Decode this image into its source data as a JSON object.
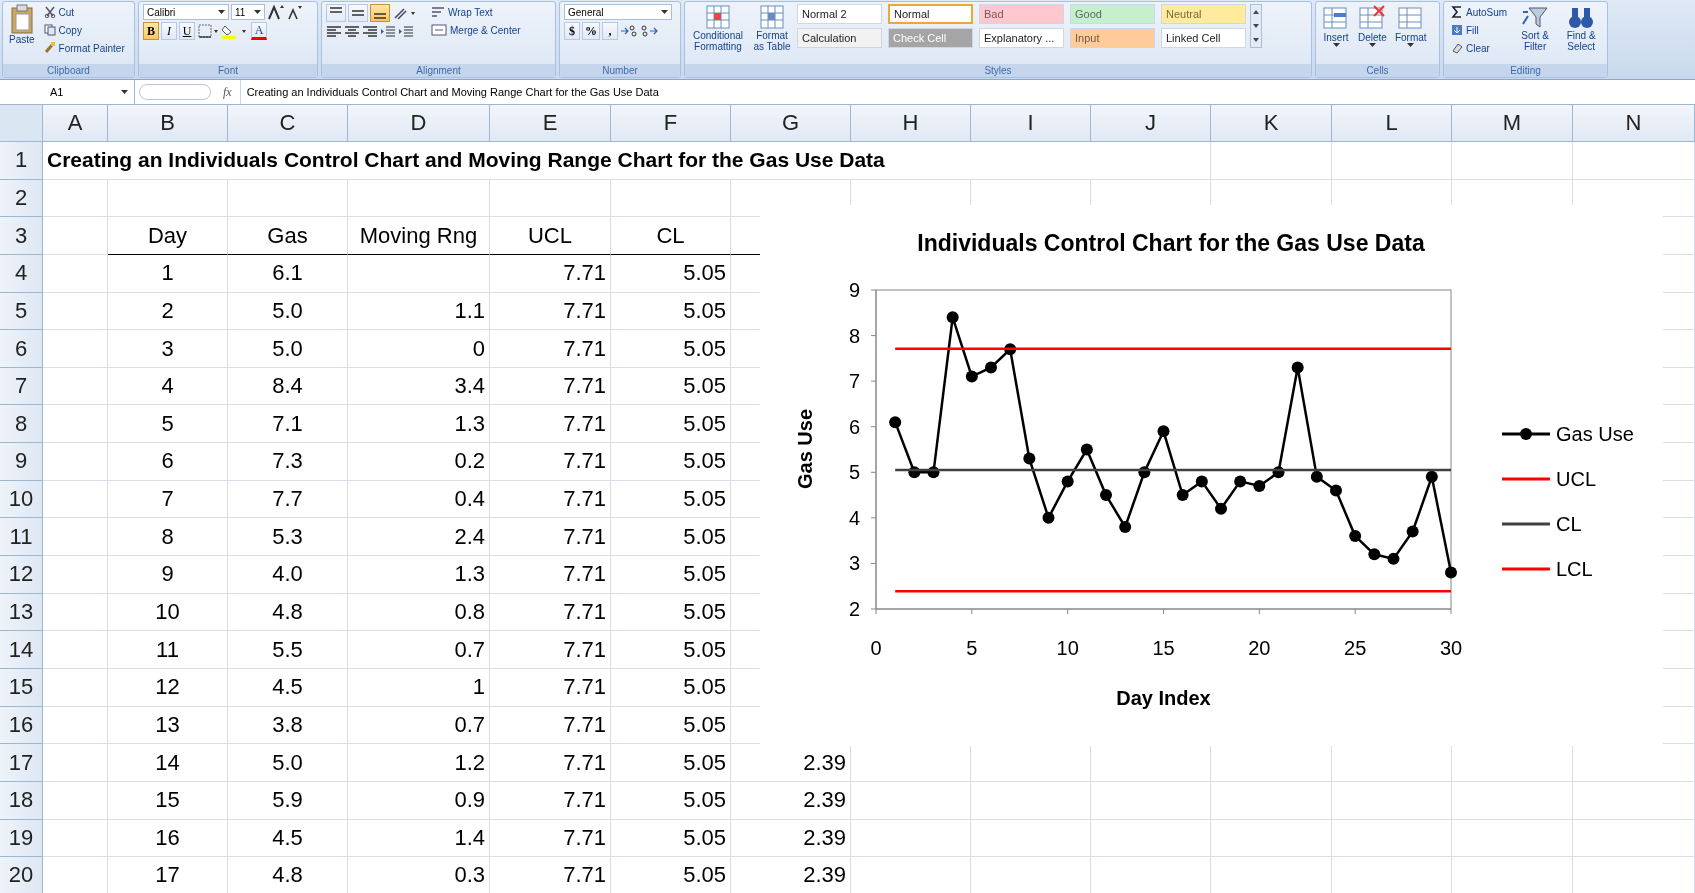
{
  "ribbon": {
    "groups": [
      {
        "kind": "clipboard",
        "label": "Clipboard",
        "paste": "Paste",
        "items": [
          "Cut",
          "Copy",
          "Format Painter"
        ]
      },
      {
        "kind": "font",
        "label": "Font",
        "font_name": "Calibri",
        "font_size": "11",
        "format_buttons": [
          {
            "label": "B",
            "selected": true
          },
          {
            "label": "I",
            "selected": false
          },
          {
            "label": "U",
            "selected": false
          }
        ],
        "font_color": "A"
      },
      {
        "kind": "alignment",
        "label": "Alignment",
        "vertical_align": [
          {
            "selected": false
          },
          {
            "selected": false
          },
          {
            "selected": true
          }
        ],
        "wrap": "Wrap Text",
        "merge": "Merge & Center"
      },
      {
        "kind": "number",
        "label": "Number",
        "format": "General",
        "symbols": [
          "$",
          "%",
          ","
        ]
      },
      {
        "kind": "styles",
        "label": "Styles",
        "buttons": [
          "Conditional Formatting",
          "Format as Table"
        ],
        "gallery": [
          {
            "label": "Normal 2",
            "color": "#ffffff",
            "selected": false
          },
          {
            "label": "Normal",
            "color": "#ffffff",
            "selected": true
          },
          {
            "label": "Bad",
            "color": "#ffc7ce",
            "selected": false
          },
          {
            "label": "Good",
            "color": "#c6efce",
            "selected": false
          },
          {
            "label": "Neutral",
            "color": "#ffeb9c",
            "selected": false
          },
          {
            "label": "Calculation",
            "color": "#f2f2f2",
            "selected": false
          },
          {
            "label": "Check Cell",
            "color": "#a5a5a5",
            "selected": false
          },
          {
            "label": "Explanatory ...",
            "color": "#ffffff",
            "selected": false
          },
          {
            "label": "Input",
            "color": "#ffcc99",
            "selected": false
          },
          {
            "label": "Linked Cell",
            "color": "#ffffff",
            "selected": false
          }
        ]
      },
      {
        "kind": "cells",
        "label": "Cells",
        "buttons": [
          "Insert",
          "Delete",
          "Format"
        ]
      },
      {
        "kind": "editing",
        "label": "Editing",
        "items": [
          "AutoSum",
          "Fill",
          "Clear"
        ],
        "buttons": [
          "Sort & Filter",
          "Find & Select"
        ]
      }
    ]
  },
  "formula_bar": {
    "name_box": "A1",
    "fx": "fx",
    "content": "Creating an Individuals Control Chart and Moving Range Chart for the Gas Use Data"
  },
  "sheet": {
    "columns": [
      "A",
      "B",
      "C",
      "D",
      "E",
      "F",
      "G",
      "H",
      "I",
      "J",
      "K",
      "L",
      "M",
      "N"
    ],
    "rows": [
      {
        "number": "1",
        "kind": "title",
        "cells": {
          "A": "Creating an Individuals Control Chart and Moving Range Chart for the Gas Use Data"
        }
      },
      {
        "number": "2",
        "kind": "data",
        "cells": {}
      },
      {
        "number": "3",
        "kind": "header",
        "cells": {
          "B": "Day",
          "C": "Gas",
          "D": "Moving Rng",
          "E": "UCL",
          "F": "CL"
        }
      },
      {
        "number": "4",
        "kind": "data",
        "cells": {
          "B": "1",
          "C": "6.1",
          "E": "7.71",
          "F": "5.05"
        }
      },
      {
        "number": "5",
        "kind": "data",
        "cells": {
          "B": "2",
          "C": "5.0",
          "D": "1.1",
          "E": "7.71",
          "F": "5.05"
        }
      },
      {
        "number": "6",
        "kind": "data",
        "cells": {
          "B": "3",
          "C": "5.0",
          "D": "0",
          "E": "7.71",
          "F": "5.05"
        }
      },
      {
        "number": "7",
        "kind": "data",
        "cells": {
          "B": "4",
          "C": "8.4",
          "D": "3.4",
          "E": "7.71",
          "F": "5.05"
        }
      },
      {
        "number": "8",
        "kind": "data",
        "cells": {
          "B": "5",
          "C": "7.1",
          "D": "1.3",
          "E": "7.71",
          "F": "5.05"
        }
      },
      {
        "number": "9",
        "kind": "data",
        "cells": {
          "B": "6",
          "C": "7.3",
          "D": "0.2",
          "E": "7.71",
          "F": "5.05"
        }
      },
      {
        "number": "10",
        "kind": "data",
        "cells": {
          "B": "7",
          "C": "7.7",
          "D": "0.4",
          "E": "7.71",
          "F": "5.05"
        }
      },
      {
        "number": "11",
        "kind": "data",
        "cells": {
          "B": "8",
          "C": "5.3",
          "D": "2.4",
          "E": "7.71",
          "F": "5.05"
        }
      },
      {
        "number": "12",
        "kind": "data",
        "cells": {
          "B": "9",
          "C": "4.0",
          "D": "1.3",
          "E": "7.71",
          "F": "5.05"
        }
      },
      {
        "number": "13",
        "kind": "data",
        "cells": {
          "B": "10",
          "C": "4.8",
          "D": "0.8",
          "E": "7.71",
          "F": "5.05"
        }
      },
      {
        "number": "14",
        "kind": "data",
        "cells": {
          "B": "11",
          "C": "5.5",
          "D": "0.7",
          "E": "7.71",
          "F": "5.05"
        }
      },
      {
        "number": "15",
        "kind": "data",
        "cells": {
          "B": "12",
          "C": "4.5",
          "D": "1",
          "E": "7.71",
          "F": "5.05"
        }
      },
      {
        "number": "16",
        "kind": "data",
        "cells": {
          "B": "13",
          "C": "3.8",
          "D": "0.7",
          "E": "7.71",
          "F": "5.05"
        }
      },
      {
        "number": "17",
        "kind": "data",
        "cells": {
          "B": "14",
          "C": "5.0",
          "D": "1.2",
          "E": "7.71",
          "F": "5.05",
          "G": "2.39"
        }
      },
      {
        "number": "18",
        "kind": "data",
        "cells": {
          "B": "15",
          "C": "5.9",
          "D": "0.9",
          "E": "7.71",
          "F": "5.05",
          "G": "2.39"
        }
      },
      {
        "number": "19",
        "kind": "data",
        "cells": {
          "B": "16",
          "C": "4.5",
          "D": "1.4",
          "E": "7.71",
          "F": "5.05",
          "G": "2.39"
        }
      },
      {
        "number": "20",
        "kind": "data",
        "cells": {
          "B": "17",
          "C": "4.8",
          "D": "0.3",
          "E": "7.71",
          "F": "5.05",
          "G": "2.39"
        }
      }
    ]
  },
  "chart": {
    "chart_data": {
      "type": "line",
      "title": "Individuals Control Chart for the Gas Use Data",
      "xlabel": "Day Index",
      "ylabel": "Gas Use",
      "x": [
        1,
        2,
        3,
        4,
        5,
        6,
        7,
        8,
        9,
        10,
        11,
        12,
        13,
        14,
        15,
        16,
        17,
        18,
        19,
        20,
        21,
        22,
        23,
        24,
        25,
        26,
        27,
        28,
        29,
        30
      ],
      "series": [
        {
          "name": "Gas Use",
          "color": "#000000",
          "marker": true,
          "values": [
            6.1,
            5.0,
            5.0,
            8.4,
            7.1,
            7.3,
            7.7,
            5.3,
            4.0,
            4.8,
            5.5,
            4.5,
            3.8,
            5.0,
            5.9,
            4.5,
            4.8,
            4.2,
            4.8,
            4.7,
            5.0,
            7.3,
            4.9,
            4.6,
            3.6,
            3.2,
            3.1,
            3.7,
            4.9,
            2.8
          ]
        },
        {
          "name": "UCL",
          "color": "#ff0000",
          "marker": false,
          "values": [
            7.71,
            7.71,
            7.71,
            7.71,
            7.71,
            7.71,
            7.71,
            7.71,
            7.71,
            7.71,
            7.71,
            7.71,
            7.71,
            7.71,
            7.71,
            7.71,
            7.71,
            7.71,
            7.71,
            7.71,
            7.71,
            7.71,
            7.71,
            7.71,
            7.71,
            7.71,
            7.71,
            7.71,
            7.71,
            7.71
          ]
        },
        {
          "name": "CL",
          "color": "#404040",
          "marker": false,
          "values": [
            5.05,
            5.05,
            5.05,
            5.05,
            5.05,
            5.05,
            5.05,
            5.05,
            5.05,
            5.05,
            5.05,
            5.05,
            5.05,
            5.05,
            5.05,
            5.05,
            5.05,
            5.05,
            5.05,
            5.05,
            5.05,
            5.05,
            5.05,
            5.05,
            5.05,
            5.05,
            5.05,
            5.05,
            5.05,
            5.05
          ]
        },
        {
          "name": "LCL",
          "color": "#ff0000",
          "marker": false,
          "values": [
            2.39,
            2.39,
            2.39,
            2.39,
            2.39,
            2.39,
            2.39,
            2.39,
            2.39,
            2.39,
            2.39,
            2.39,
            2.39,
            2.39,
            2.39,
            2.39,
            2.39,
            2.39,
            2.39,
            2.39,
            2.39,
            2.39,
            2.39,
            2.39,
            2.39,
            2.39,
            2.39,
            2.39,
            2.39,
            2.39
          ]
        }
      ],
      "xlim": [
        0,
        30
      ],
      "ylim": [
        2,
        9
      ],
      "xticks": [
        {
          "value": 0,
          "label": "0"
        },
        {
          "value": 5,
          "label": "5"
        },
        {
          "value": 10,
          "label": "10"
        },
        {
          "value": 15,
          "label": "15"
        },
        {
          "value": 20,
          "label": "20"
        },
        {
          "value": 25,
          "label": "25"
        },
        {
          "value": 30,
          "label": "30"
        }
      ],
      "yticks": [
        {
          "value": 2,
          "label": "2"
        },
        {
          "value": 3,
          "label": "3"
        },
        {
          "value": 4,
          "label": "4"
        },
        {
          "value": 5,
          "label": "5"
        },
        {
          "value": 6,
          "label": "6"
        },
        {
          "value": 7,
          "label": "7"
        },
        {
          "value": 8,
          "label": "8"
        },
        {
          "value": 9,
          "label": "9"
        }
      ],
      "legend": true
    }
  }
}
